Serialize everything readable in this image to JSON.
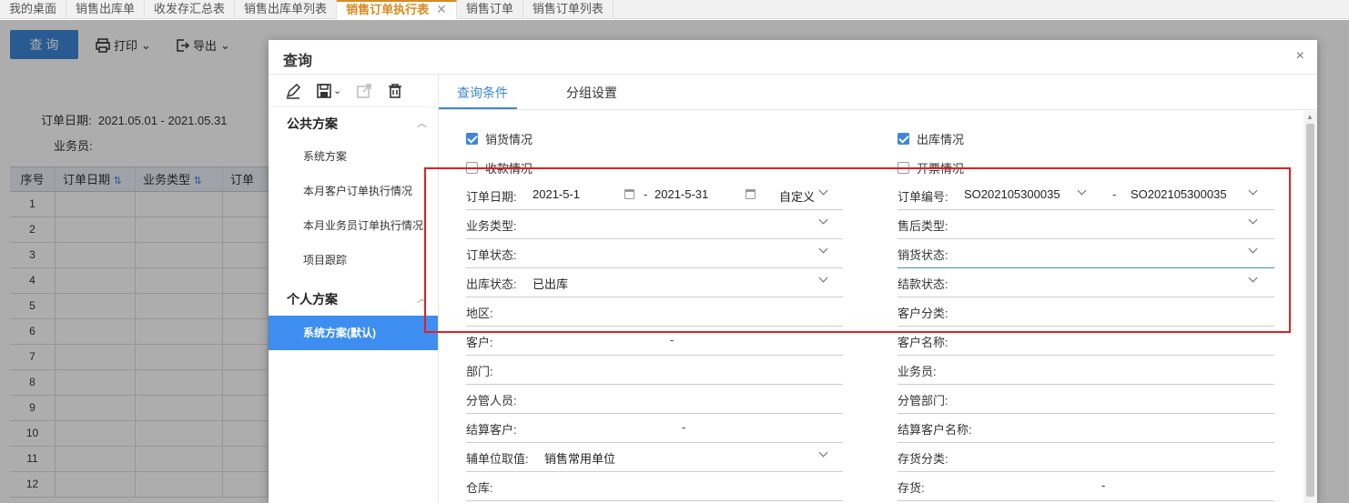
{
  "tabs": [
    {
      "label": "我的桌面"
    },
    {
      "label": "销售出库单"
    },
    {
      "label": "收发存汇总表"
    },
    {
      "label": "销售出库单列表"
    },
    {
      "label": "销售订单执行表"
    },
    {
      "label": "销售订单"
    },
    {
      "label": "销售订单列表"
    }
  ],
  "toolbar": {
    "query_label": "查 询",
    "print_label": "打印",
    "export_label": "导出"
  },
  "filters": {
    "order_date_label": "订单日期:",
    "order_date_value": "2021.05.01 - 2021.05.31",
    "salesman_label": "业务员:"
  },
  "grid": {
    "headers": [
      "序号",
      "订单日期",
      "业务类型",
      "订单"
    ],
    "rows": [
      "1",
      "2",
      "3",
      "4",
      "5",
      "6",
      "7",
      "8",
      "9",
      "10",
      "11",
      "12"
    ]
  },
  "dialog": {
    "title": "查询",
    "close": "×",
    "left": {
      "public_section": "公共方案",
      "public_items": [
        "系统方案",
        "本月客户订单执行情况",
        "本月业务员订单执行情况",
        "项目跟踪"
      ],
      "personal_section": "个人方案",
      "personal_items": [
        "系统方案(默认)"
      ]
    },
    "tabs": [
      "查询条件",
      "分组设置"
    ],
    "checkboxes": {
      "sales": {
        "label": "销货情况",
        "checked": true
      },
      "outbound": {
        "label": "出库情况",
        "checked": true
      },
      "receipt": {
        "label": "收款情况",
        "checked": false
      },
      "invoice": {
        "label": "开票情况",
        "checked": false
      }
    },
    "fields": {
      "order_date": {
        "label": "订单日期:",
        "from": "2021-5-1",
        "sep": "-",
        "to": "2021-5-31",
        "mode": "自定义"
      },
      "order_no": {
        "label": "订单编号:",
        "from": "SO202105300035",
        "sep": "-",
        "to": "SO202105300035"
      },
      "biz_type": {
        "label": "业务类型:"
      },
      "aftersale_type": {
        "label": "售后类型:"
      },
      "order_status": {
        "label": "订单状态:"
      },
      "sales_status": {
        "label": "销货状态:"
      },
      "outbound_status": {
        "label": "出库状态:",
        "value": "已出库"
      },
      "settle_status": {
        "label": "结款状态:"
      },
      "region": {
        "label": "地区:"
      },
      "customer_class": {
        "label": "客户分类:"
      },
      "customer": {
        "label": "客户:",
        "sep": "-"
      },
      "customer_name": {
        "label": "客户名称:"
      },
      "department": {
        "label": "部门:"
      },
      "salesman": {
        "label": "业务员:"
      },
      "manager": {
        "label": "分管人员:"
      },
      "manager_dept": {
        "label": "分管部门:"
      },
      "settle_customer": {
        "label": "结算客户:",
        "sep": "-"
      },
      "settle_customer_name": {
        "label": "结算客户名称:"
      },
      "aux_unit": {
        "label": "辅单位取值:",
        "value": "销售常用单位"
      },
      "stock_class": {
        "label": "存货分类:"
      },
      "warehouse": {
        "label": "仓库:"
      },
      "stock": {
        "label": "存货:",
        "sep": "-"
      }
    }
  }
}
